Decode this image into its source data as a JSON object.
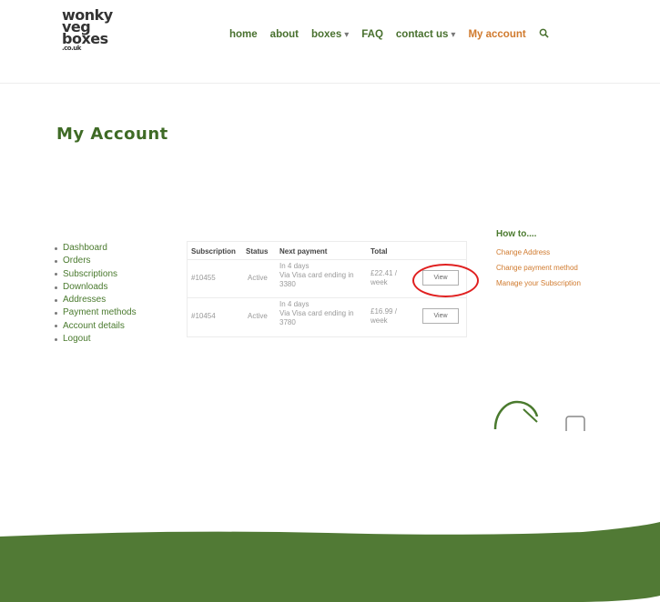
{
  "brand": {
    "logo_lines": [
      "wonky",
      "veg",
      "boxes",
      ".co.uk"
    ]
  },
  "nav": {
    "items": [
      {
        "label": "home",
        "dropdown": false,
        "active": false
      },
      {
        "label": "about",
        "dropdown": false,
        "active": false
      },
      {
        "label": "boxes",
        "dropdown": true,
        "active": false
      },
      {
        "label": "FAQ",
        "dropdown": false,
        "active": false
      },
      {
        "label": "contact us",
        "dropdown": true,
        "active": false
      },
      {
        "label": "My account",
        "dropdown": false,
        "active": true
      }
    ],
    "dropdown_glyph": "▾",
    "search_icon": "search-icon"
  },
  "page": {
    "title": "My Account"
  },
  "account_menu": [
    "Dashboard",
    "Orders",
    "Subscriptions",
    "Downloads",
    "Addresses",
    "Payment methods",
    "Account details",
    "Logout"
  ],
  "subscriptions": {
    "columns": [
      "Subscription",
      "Status",
      "Next payment",
      "Total"
    ],
    "rows": [
      {
        "id": "#10455",
        "status": "Active",
        "next_payment": [
          "In 4 days",
          "Via Visa card ending in",
          "3380"
        ],
        "total": [
          "£22.41 /",
          "week"
        ],
        "action": "View"
      },
      {
        "id": "#10454",
        "status": "Active",
        "next_payment": [
          "In 4 days",
          "Via Visa card ending in",
          "3780"
        ],
        "total": [
          "£16.99 /",
          "week"
        ],
        "action": "View"
      }
    ]
  },
  "howto": {
    "title": "How to....",
    "links": [
      "Change Address",
      "Change payment method",
      "Manage your Subscription"
    ]
  },
  "colors": {
    "brand_green": "#4a7a2e",
    "accent_orange": "#d07a2e",
    "footer_green": "#517a35",
    "highlight_red": "#e02020"
  }
}
